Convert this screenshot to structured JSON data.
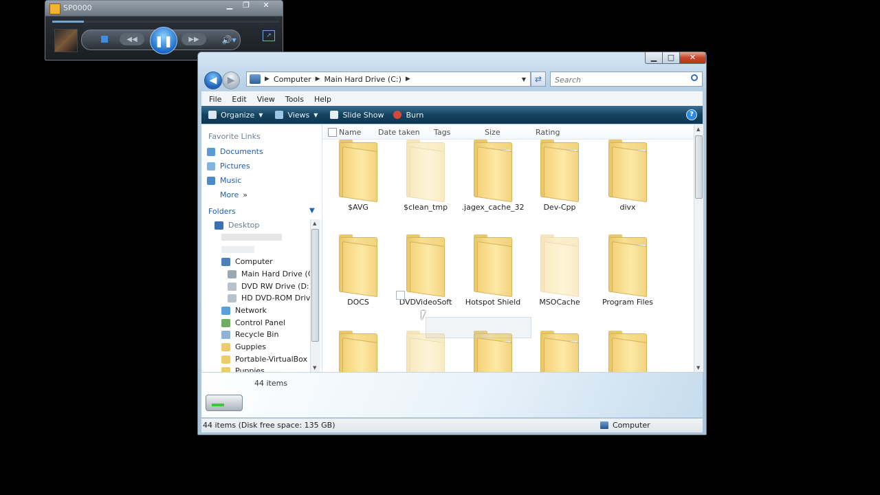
{
  "media_player": {
    "title": "SP0000"
  },
  "explorer": {
    "address": {
      "segments": [
        "Computer",
        "Main Hard Drive (C:)"
      ]
    },
    "search": {
      "placeholder": "Search"
    },
    "menu": [
      "File",
      "Edit",
      "View",
      "Tools",
      "Help"
    ],
    "toolbar": {
      "organize": "Organize",
      "views": "Views",
      "slideshow": "Slide Show",
      "burn": "Burn"
    },
    "nav": {
      "favorites_header": "Favorite Links",
      "favorites": [
        "Documents",
        "Pictures",
        "Music",
        "More"
      ],
      "more_chevron": "»",
      "folders_header": "Folders",
      "tree": [
        "Desktop",
        "Computer",
        "Main Hard Drive (C:)",
        "DVD RW Drive (D:)",
        "HD DVD-ROM Drive",
        "Network",
        "Control Panel",
        "Recycle Bin",
        "Guppies",
        "Portable-VirtualBox",
        "Puppies"
      ]
    },
    "columns": [
      "Name",
      "Date taken",
      "Tags",
      "Size",
      "Rating"
    ],
    "folders": [
      {
        "name": "$AVG",
        "faded": false,
        "has_page": false
      },
      {
        "name": "$clean_tmp",
        "faded": true,
        "has_page": false
      },
      {
        "name": ".jagex_cache_32",
        "faded": false,
        "has_page": true
      },
      {
        "name": "Dev-Cpp",
        "faded": false,
        "has_page": true
      },
      {
        "name": "divx",
        "faded": false,
        "has_page": true
      },
      {
        "name": "DOCS",
        "faded": false,
        "has_page": false
      },
      {
        "name": "DVDVideoSoft",
        "faded": false,
        "has_page": false
      },
      {
        "name": "Hotspot Shield",
        "faded": false,
        "has_page": false
      },
      {
        "name": "MSOCache",
        "faded": true,
        "has_page": false
      },
      {
        "name": "Program Files",
        "faded": false,
        "has_page": true
      }
    ],
    "details": {
      "count": "44 items"
    },
    "status": {
      "left": "44 items (Disk free space: 135 GB)",
      "right": "Computer"
    }
  }
}
